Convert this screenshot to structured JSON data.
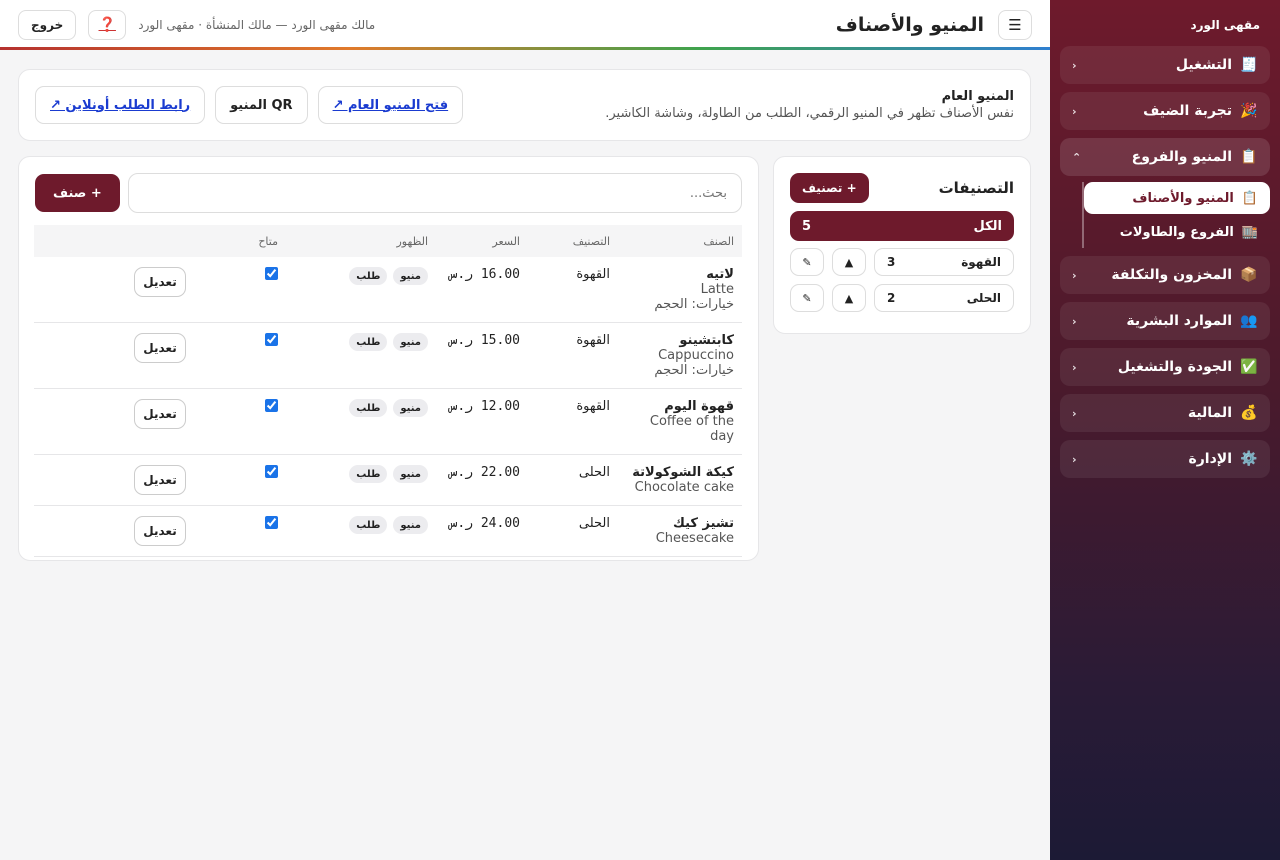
{
  "sidebar": {
    "brand": "مقهى الورد",
    "groups": [
      {
        "label": "التشغيل",
        "icon": "🧾",
        "chevron": "‹"
      },
      {
        "label": "تجربة الضيف",
        "icon": "🎉",
        "chevron": "‹"
      },
      {
        "label": "المنيو والفروع",
        "icon": "📋",
        "chevron": "⌃"
      },
      {
        "label": "المخزون والتكلفة",
        "icon": "📦",
        "chevron": "‹"
      },
      {
        "label": "الموارد البشرية",
        "icon": "👥",
        "chevron": "‹"
      },
      {
        "label": "الجودة والتشغيل",
        "icon": "✅",
        "chevron": "‹"
      },
      {
        "label": "المالية",
        "icon": "💰",
        "chevron": "‹"
      },
      {
        "label": "الإدارة",
        "icon": "⚙️",
        "chevron": "‹"
      }
    ],
    "subitems": [
      {
        "label": "المنيو والأصناف",
        "icon": "📋"
      },
      {
        "label": "الفروع والطاولات",
        "icon": "🏬"
      }
    ]
  },
  "topbar": {
    "menu_icon": "☰",
    "title": "المنيو والأصناف",
    "meta": "مالك مقهى الورد — مالك المنشأة · مقهى الورد",
    "help_icon": "❓",
    "logout": "خروج"
  },
  "public_menu": {
    "title": "المنيو العام",
    "description": "نفس الأصناف تظهر في المنيو الرقمي، الطلب من الطاولة، وشاشة الكاشير.",
    "open_public": "فتح المنيو العام ↗",
    "qr": "QR المنيو",
    "online_link": "رابط الطلب أونلاين ↗"
  },
  "categories": {
    "title": "التصنيفات",
    "add_label": "+ تصنيف",
    "all_label": "الكل",
    "all_count": "5",
    "up_icon": "▲",
    "edit_icon": "✎",
    "rows": [
      {
        "name": "القهوة",
        "count": "3"
      },
      {
        "name": "الحلى",
        "count": "2"
      }
    ]
  },
  "items": {
    "search_placeholder": "بحث...",
    "add_label": "+ صنف",
    "columns": [
      "الصنف",
      "التصنيف",
      "السعر",
      "الظهور",
      "متاح"
    ],
    "edit_label": "تعديل",
    "rows": [
      {
        "name_ar": "لاتيه",
        "name_en": "Latte",
        "options": "خيارات: الحجم",
        "category": "القهوة",
        "price": "16.00 ر.س",
        "chips": [
          "منيو",
          "طلب"
        ],
        "available": true
      },
      {
        "name_ar": "كابتشينو",
        "name_en": "Cappuccino",
        "options": "خيارات: الحجم",
        "category": "القهوة",
        "price": "15.00 ر.س",
        "chips": [
          "منيو",
          "طلب"
        ],
        "available": true
      },
      {
        "name_ar": "قهوة اليوم",
        "name_en": "Coffee of the day",
        "options": "",
        "category": "القهوة",
        "price": "12.00 ر.س",
        "chips": [
          "منيو",
          "طلب"
        ],
        "available": true
      },
      {
        "name_ar": "كيكة الشوكولاتة",
        "name_en": "Chocolate cake",
        "options": "",
        "category": "الحلى",
        "price": "22.00 ر.س",
        "chips": [
          "منيو",
          "طلب"
        ],
        "available": true
      },
      {
        "name_ar": "تشيز كيك",
        "name_en": "Cheesecake",
        "options": "",
        "category": "الحلى",
        "price": "24.00 ر.س",
        "chips": [
          "منيو",
          "طلب"
        ],
        "available": true
      }
    ]
  },
  "colors": {
    "accent": "#6e1a2c",
    "link": "#1a3bd0"
  }
}
